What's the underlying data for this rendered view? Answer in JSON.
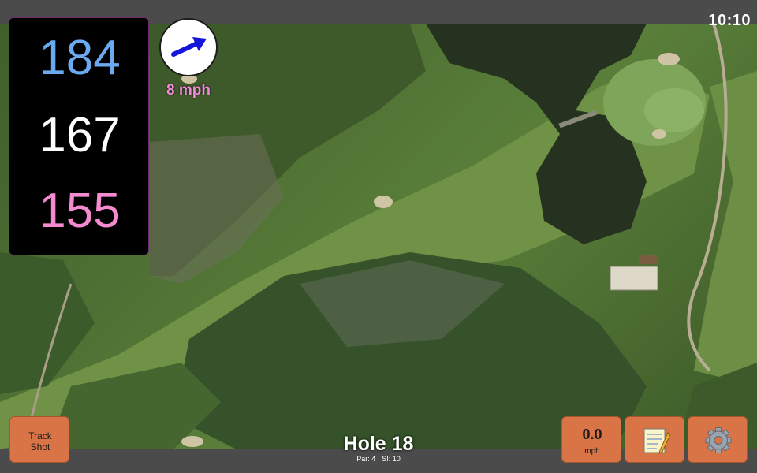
{
  "status": {
    "time": "10:10"
  },
  "distances": {
    "back": "184",
    "middle": "167",
    "front": "155"
  },
  "wind": {
    "speed": "8 mph",
    "icon": "wind-direction-arrow-icon"
  },
  "hole": {
    "title": "Hole 18",
    "par": "Par: 4",
    "si": "SI: 10"
  },
  "buttons": {
    "track_shot": [
      "Track",
      "Shot"
    ],
    "speed_value": "0.0",
    "speed_unit": "mph",
    "notes_icon": "notepad-icon",
    "settings_icon": "gear-icon"
  },
  "colors": {
    "back_distance": "#6aaaf0",
    "middle_distance": "#ffffff",
    "front_distance": "#f58ad0",
    "button": "#d87445",
    "wind_text": "#f08ad8"
  }
}
